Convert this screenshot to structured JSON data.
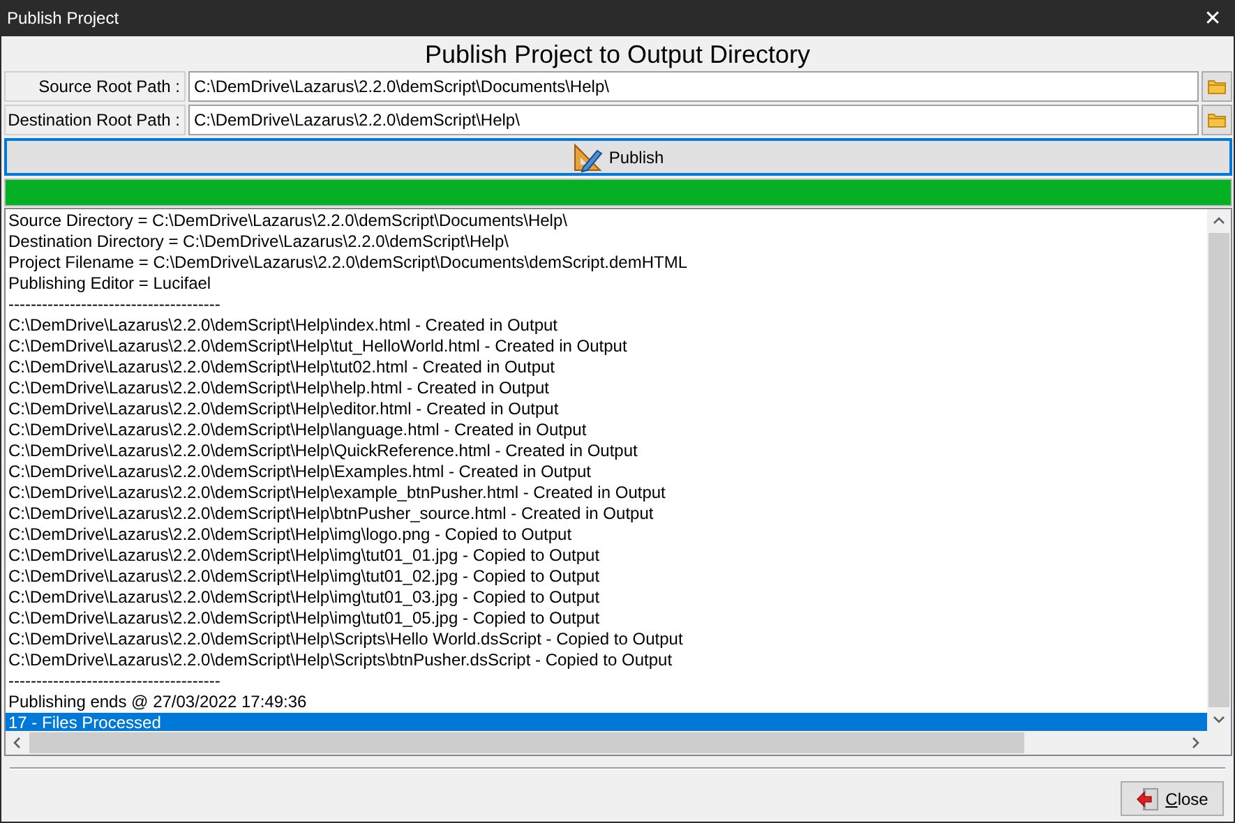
{
  "window": {
    "title": "Publish Project",
    "close": "✕"
  },
  "heading": "Publish Project to Output Directory",
  "paths": [
    {
      "label": "Source Root Path :",
      "value": "C:\\DemDrive\\Lazarus\\2.2.0\\demScript\\Documents\\Help\\"
    },
    {
      "label": "Destination Root Path :",
      "value": "C:\\DemDrive\\Lazarus\\2.2.0\\demScript\\Help\\"
    }
  ],
  "publish_button": {
    "label": "Publish"
  },
  "progress": {
    "level": 1
  },
  "log": {
    "lines": [
      {
        "text": "Source Directory = C:\\DemDrive\\Lazarus\\2.2.0\\demScript\\Documents\\Help\\",
        "selected": false
      },
      {
        "text": "Destination Directory = C:\\DemDrive\\Lazarus\\2.2.0\\demScript\\Help\\",
        "selected": false
      },
      {
        "text": "Project Filename = C:\\DemDrive\\Lazarus\\2.2.0\\demScript\\Documents\\demScript.demHTML",
        "selected": false
      },
      {
        "text": "Publishing Editor = Lucifael",
        "selected": false
      },
      {
        "text": "--------------------------------------",
        "selected": false
      },
      {
        "text": "C:\\DemDrive\\Lazarus\\2.2.0\\demScript\\Help\\index.html - Created in Output",
        "selected": false
      },
      {
        "text": "C:\\DemDrive\\Lazarus\\2.2.0\\demScript\\Help\\tut_HelloWorld.html - Created in Output",
        "selected": false
      },
      {
        "text": "C:\\DemDrive\\Lazarus\\2.2.0\\demScript\\Help\\tut02.html - Created in Output",
        "selected": false
      },
      {
        "text": "C:\\DemDrive\\Lazarus\\2.2.0\\demScript\\Help\\help.html - Created in Output",
        "selected": false
      },
      {
        "text": "C:\\DemDrive\\Lazarus\\2.2.0\\demScript\\Help\\editor.html - Created in Output",
        "selected": false
      },
      {
        "text": "C:\\DemDrive\\Lazarus\\2.2.0\\demScript\\Help\\language.html - Created in Output",
        "selected": false
      },
      {
        "text": "C:\\DemDrive\\Lazarus\\2.2.0\\demScript\\Help\\QuickReference.html - Created in Output",
        "selected": false
      },
      {
        "text": "C:\\DemDrive\\Lazarus\\2.2.0\\demScript\\Help\\Examples.html - Created in Output",
        "selected": false
      },
      {
        "text": "C:\\DemDrive\\Lazarus\\2.2.0\\demScript\\Help\\example_btnPusher.html - Created in Output",
        "selected": false
      },
      {
        "text": "C:\\DemDrive\\Lazarus\\2.2.0\\demScript\\Help\\btnPusher_source.html - Created in Output",
        "selected": false
      },
      {
        "text": "C:\\DemDrive\\Lazarus\\2.2.0\\demScript\\Help\\img\\logo.png - Copied to Output",
        "selected": false
      },
      {
        "text": "C:\\DemDrive\\Lazarus\\2.2.0\\demScript\\Help\\img\\tut01_01.jpg - Copied to Output",
        "selected": false
      },
      {
        "text": "C:\\DemDrive\\Lazarus\\2.2.0\\demScript\\Help\\img\\tut01_02.jpg - Copied to Output",
        "selected": false
      },
      {
        "text": "C:\\DemDrive\\Lazarus\\2.2.0\\demScript\\Help\\img\\tut01_03.jpg - Copied to Output",
        "selected": false
      },
      {
        "text": "C:\\DemDrive\\Lazarus\\2.2.0\\demScript\\Help\\img\\tut01_05.jpg - Copied to Output",
        "selected": false
      },
      {
        "text": "C:\\DemDrive\\Lazarus\\2.2.0\\demScript\\Help\\Scripts\\Hello World.dsScript - Copied to Output",
        "selected": false
      },
      {
        "text": "C:\\DemDrive\\Lazarus\\2.2.0\\demScript\\Help\\Scripts\\btnPusher.dsScript - Copied to Output",
        "selected": false
      },
      {
        "text": "--------------------------------------",
        "selected": false
      },
      {
        "text": "Publishing ends @ 27/03/2022 17:49:36",
        "selected": false
      },
      {
        "text": "17 - Files Processed",
        "selected": true
      }
    ]
  },
  "close_button": {
    "label": "Close"
  }
}
